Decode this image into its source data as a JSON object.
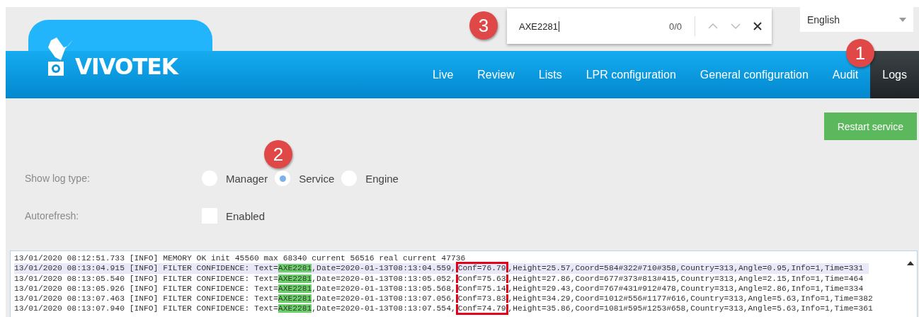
{
  "language": {
    "value": "English"
  },
  "find_bar": {
    "query": "AXE2281",
    "count": "0/0"
  },
  "logo": {
    "text": "VIVOTEK"
  },
  "nav": [
    {
      "label": "Live",
      "selected": false
    },
    {
      "label": "Review",
      "selected": false
    },
    {
      "label": "Lists",
      "selected": false
    },
    {
      "label": "LPR configuration",
      "selected": false
    },
    {
      "label": "General configuration",
      "selected": false
    },
    {
      "label": "Audit",
      "selected": false
    },
    {
      "label": "Logs",
      "selected": true
    }
  ],
  "restart_button": "Restart service",
  "log_type": {
    "label": "Show log type:",
    "options": [
      {
        "label": "Manager",
        "selected": false
      },
      {
        "label": "Service",
        "selected": true
      },
      {
        "label": "Engine",
        "selected": false
      }
    ]
  },
  "autorefresh": {
    "label": "Autorefresh:",
    "option": {
      "label": "Enabled",
      "checked": false
    }
  },
  "log_lines": [
    {
      "selected": false,
      "segments": [
        {
          "kind": "plain",
          "text": "13/01/2020 08:12:51.733 [INFO] MEMORY OK init 45560 max 68340 current 56516 real current 47736"
        }
      ]
    },
    {
      "selected": true,
      "segments": [
        {
          "kind": "plain",
          "text": "13/01/2020 08:13:04.915 [INFO] FILTER CONFIDENCE: Text="
        },
        {
          "kind": "match",
          "text": "AXE2281"
        },
        {
          "kind": "plain",
          "text": ",Date=2020-01-13T08:13:04.559,"
        },
        {
          "kind": "boxed",
          "text": "Conf=76.79"
        },
        {
          "kind": "plain",
          "text": ",Height=25.57,Coord=584#322#710#358,Country=313,Angle=0.95,Info=1,Time=331"
        }
      ]
    },
    {
      "selected": false,
      "segments": [
        {
          "kind": "plain",
          "text": "13/01/2020 08:13:05.540 [INFO] FILTER CONFIDENCE: Text="
        },
        {
          "kind": "match",
          "text": "AXE2281"
        },
        {
          "kind": "plain",
          "text": ",Date=2020-01-13T08:13:05.052,"
        },
        {
          "kind": "boxed",
          "text": "Conf=75.63"
        },
        {
          "kind": "plain",
          "text": ",Height=27.86,Coord=677#373#813#415,Country=313,Angle=2.15,Info=1,Time=464"
        }
      ]
    },
    {
      "selected": false,
      "segments": [
        {
          "kind": "plain",
          "text": "13/01/2020 08:13:05.926 [INFO] FILTER CONFIDENCE: Text="
        },
        {
          "kind": "match",
          "text": "AXE2281"
        },
        {
          "kind": "plain",
          "text": ",Date=2020-01-13T08:13:05.568,"
        },
        {
          "kind": "boxed",
          "text": "Conf=75.14"
        },
        {
          "kind": "plain",
          "text": ",Height=29.43,Coord=767#431#912#478,Country=313,Angle=2.86,Info=1,Time=334"
        }
      ]
    },
    {
      "selected": false,
      "segments": [
        {
          "kind": "plain",
          "text": "13/01/2020 08:13:07.463 [INFO] FILTER CONFIDENCE: Text="
        },
        {
          "kind": "match",
          "text": "AXE2281"
        },
        {
          "kind": "plain",
          "text": ",Date=2020-01-13T08:13:07.056,"
        },
        {
          "kind": "boxed",
          "text": "Conf=73.83"
        },
        {
          "kind": "plain",
          "text": ",Height=34.29,Coord=1012#556#1177#616,Country=313,Angle=5.63,Info=1,Time=382"
        }
      ]
    },
    {
      "selected": false,
      "segments": [
        {
          "kind": "plain",
          "text": "13/01/2020 08:13:07.940 [INFO] FILTER CONFIDENCE: Text="
        },
        {
          "kind": "match",
          "text": "AXE2281"
        },
        {
          "kind": "plain",
          "text": ",Date=2020-01-13T08:13:07.554,"
        },
        {
          "kind": "boxed",
          "text": "Conf=74.79"
        },
        {
          "kind": "plain",
          "text": ",Height=35.86,Coord=1081#595#1253#658,Country=313,Angle=5.63,Info=1,Time=361"
        }
      ]
    }
  ],
  "annotations": [
    {
      "label": "3"
    },
    {
      "label": "1"
    },
    {
      "label": "2"
    }
  ]
}
